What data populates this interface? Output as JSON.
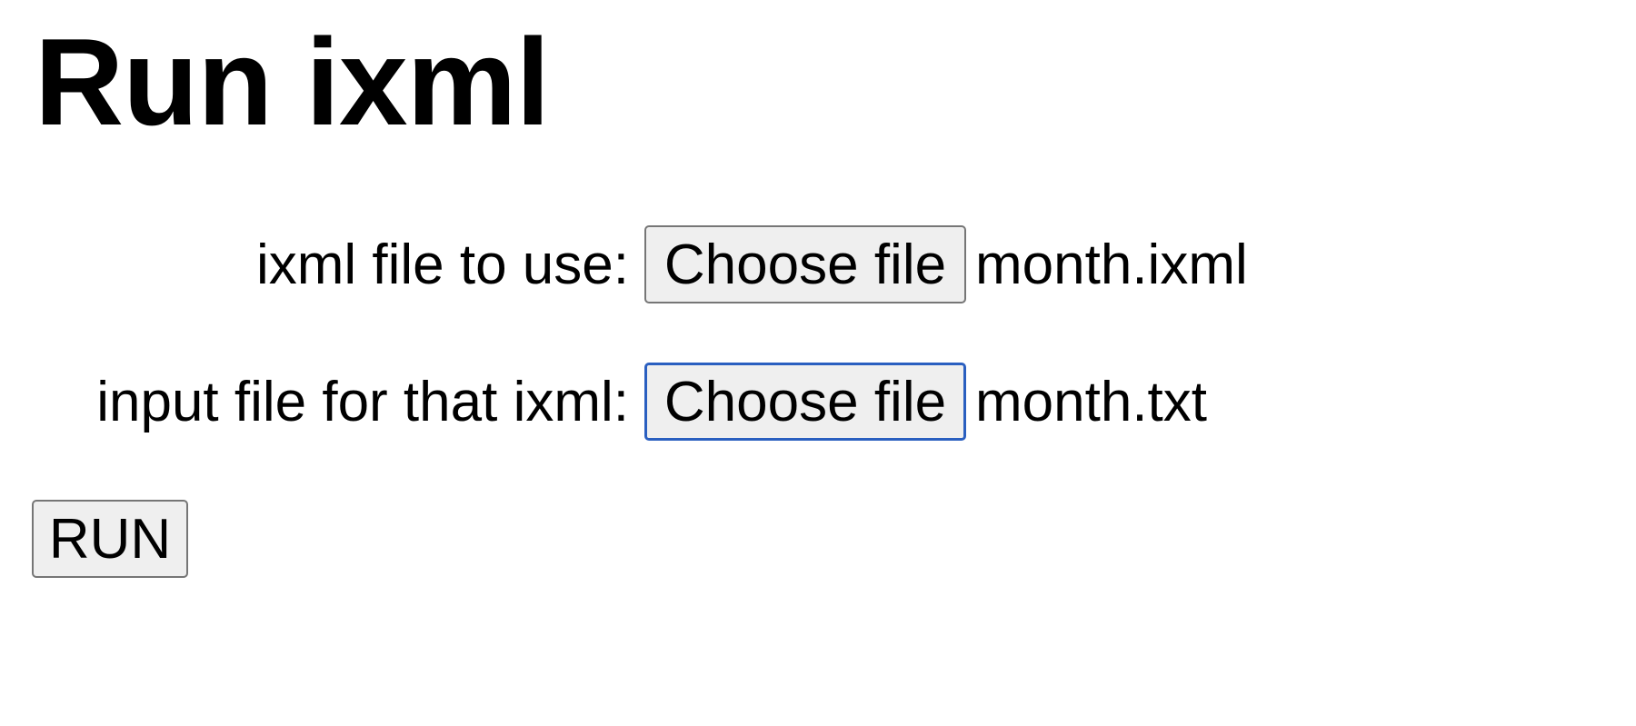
{
  "page": {
    "title": "Run ixml"
  },
  "form": {
    "ixml_field": {
      "label": "ixml file to use:",
      "button_label": "Choose file",
      "selected_file": "month.ixml"
    },
    "input_field": {
      "label": "input file for that ixml:",
      "button_label": "Choose file",
      "selected_file": "month.txt",
      "focused": true
    },
    "run_button_label": "RUN"
  },
  "colors": {
    "button_background": "#efefef",
    "button_border": "#767676",
    "focus_ring": "#2a5fc0",
    "text": "#000000",
    "background": "#ffffff"
  }
}
